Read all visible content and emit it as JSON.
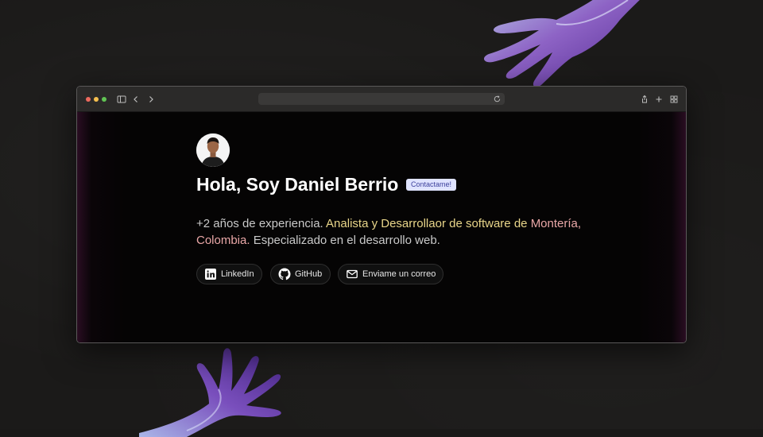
{
  "browser": {
    "url": ""
  },
  "profile": {
    "avatar_alt": "avatar"
  },
  "hero": {
    "title": "Hola, Soy Daniel Berrio",
    "badge": "Contactame!",
    "desc_part1": "+2 años de experiencia. ",
    "desc_highlight1": "Analista y Desarrollaor de software de",
    "desc_space": " ",
    "desc_highlight2": "Montería, Colombia.",
    "desc_part2": " Especializado en el desarrollo web."
  },
  "links": {
    "linkedin": "LinkedIn",
    "github": "GitHub",
    "email": "Enviame un correo"
  },
  "colors": {
    "highlight_yellow": "#e9d68a",
    "highlight_pink": "#e9a7a7",
    "badge_bg": "#dfe3ff"
  },
  "icons": [
    "sidebar-icon",
    "back-icon",
    "forward-icon",
    "reload-icon",
    "share-icon",
    "plus-icon",
    "tabs-grid-icon",
    "linkedin-icon",
    "github-icon",
    "mail-icon"
  ]
}
